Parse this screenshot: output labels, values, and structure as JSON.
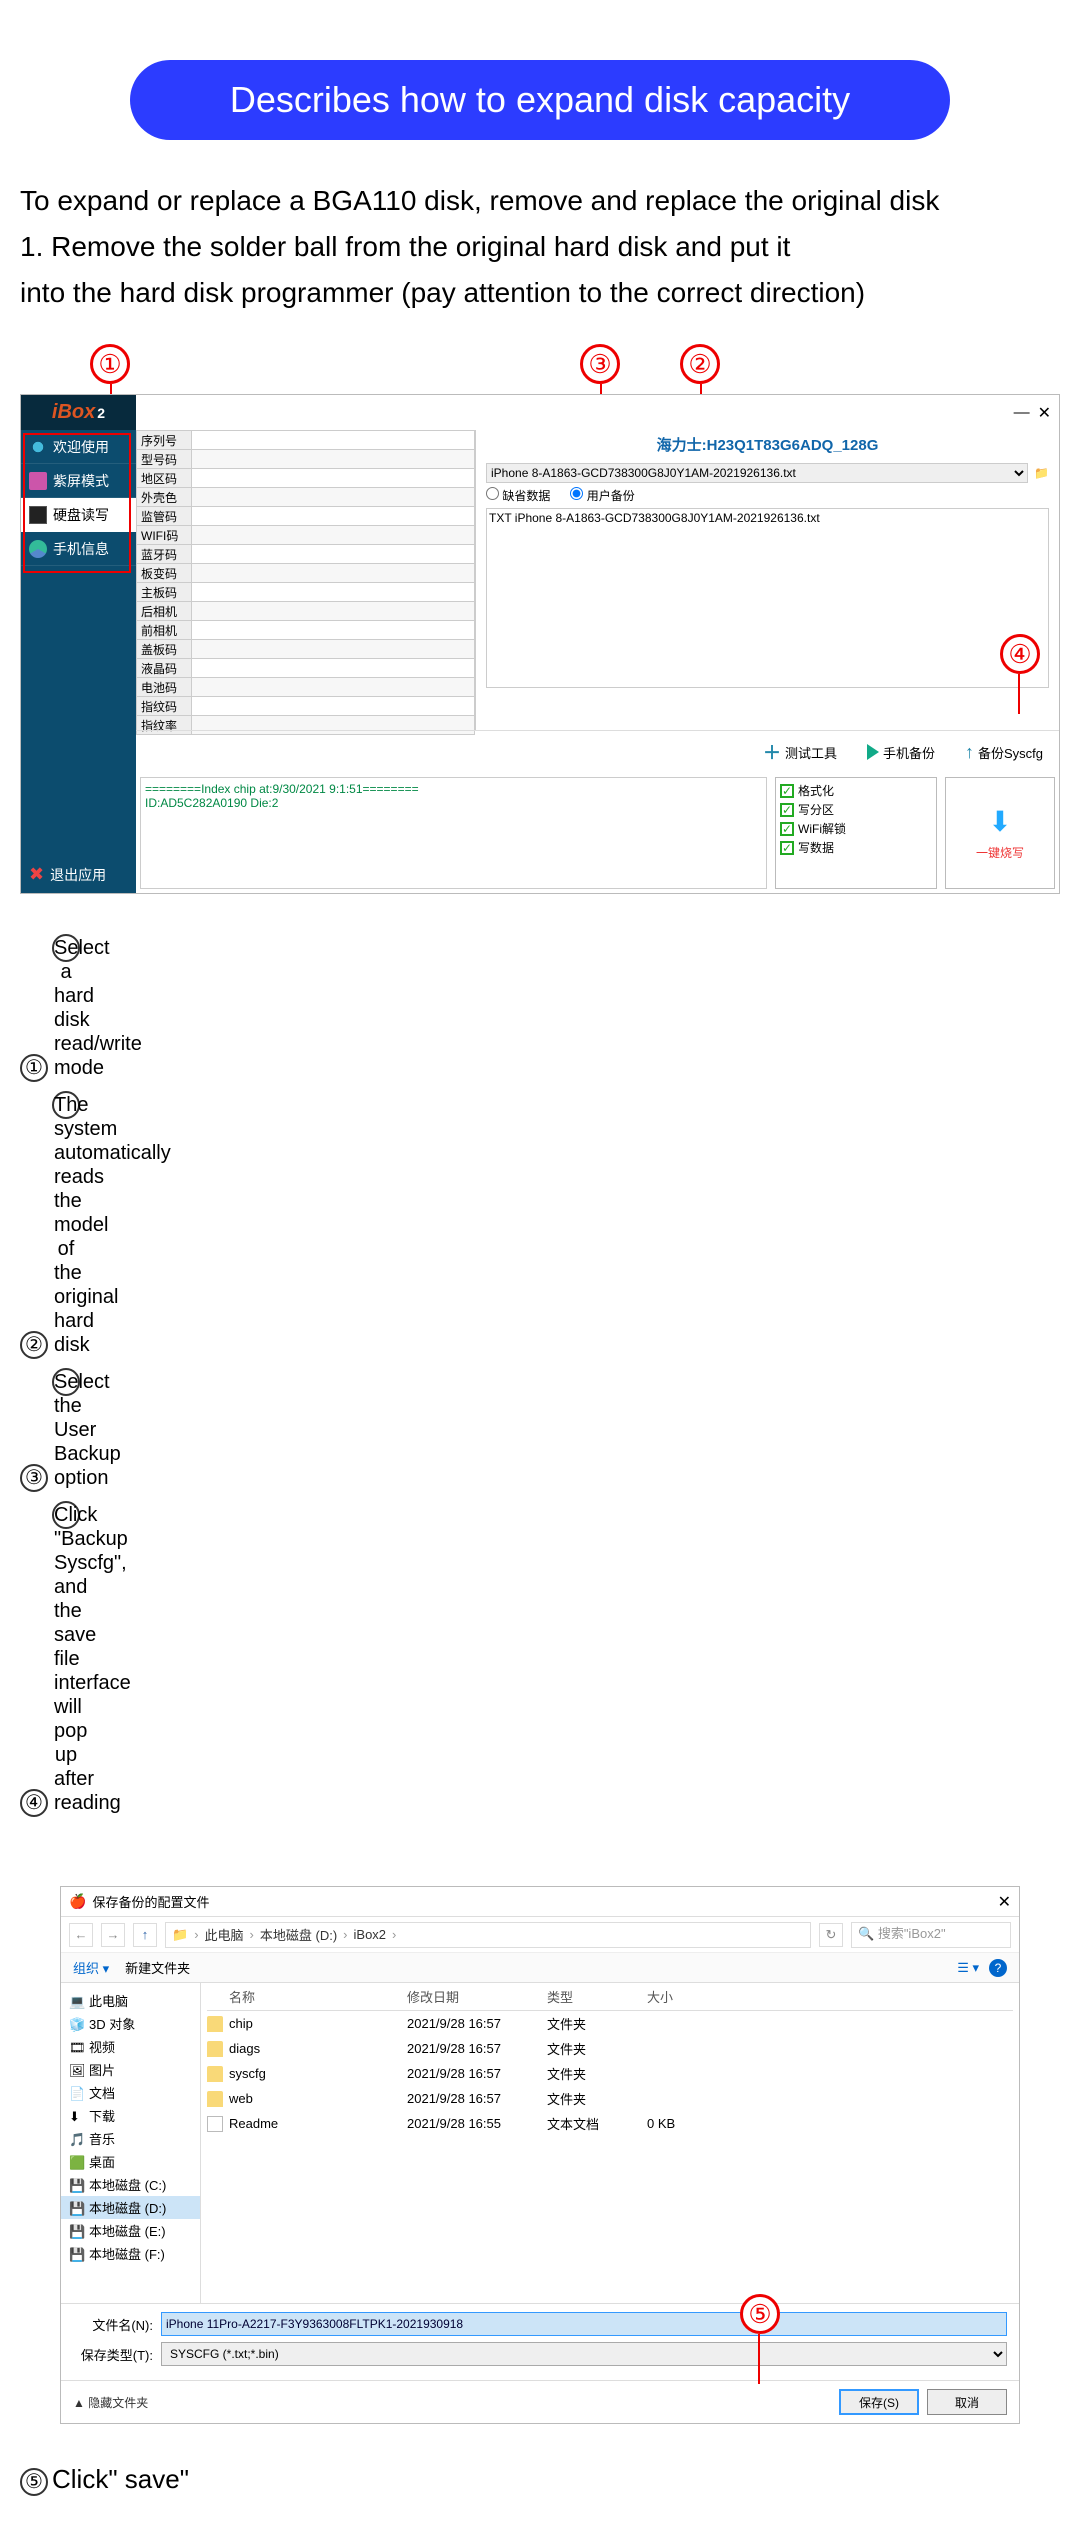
{
  "banner": "Describes how to expand disk capacity",
  "intro": [
    "To expand or replace a BGA110 disk, remove and replace the original disk",
    "1. Remove the solder ball from the original hard disk and put it",
    "into the hard disk programmer (pay attention to the correct direction)"
  ],
  "app": {
    "logo": "iBox",
    "logo2": "2",
    "sidebar": {
      "welcome": "欢迎使用",
      "purple": "紫屏模式",
      "hdd": "硬盘读写",
      "phone": "手机信息",
      "exit": "退出应用"
    },
    "props": [
      "序列号",
      "型号码",
      "地区码",
      "外壳色",
      "监管码",
      "WIFI码",
      "蓝牙码",
      "板变码",
      "主板码",
      "后相机",
      "前相机",
      "盖板码",
      "液晶码",
      "电池码",
      "指纹码",
      "指纹率"
    ],
    "chipLabel": "海力士:H23Q1T83G6ADQ_128G",
    "fileSelect": "iPhone 8-A1863-GCD738300G8J0Y1AM-2021926136.txt",
    "radio1": "缺省数据",
    "radio2": "用户备份",
    "fileListItem": "TXT iPhone 8-A1863-GCD738300G8J0Y1AM-2021926136.txt",
    "tools": {
      "test": "测试工具",
      "backup": "手机备份",
      "syscfg": "备份Syscfg"
    },
    "log": [
      "========Index chip at:9/30/2021 9:1:51========",
      "ID:AD5C282A0190 Die:2"
    ],
    "checks": [
      "格式化",
      "写分区",
      "WiFi解锁",
      "写数据"
    ],
    "burn": "一键烧写"
  },
  "steps": [
    "Select a hard disk read/write mode",
    "The system automatically reads the model of the original hard disk",
    "Select the User Backup option",
    "Click \"Backup Syscfg\", and the save file interface will pop up after reading"
  ],
  "dialog": {
    "title": "保存备份的配置文件",
    "crumbs": [
      "此电脑",
      "本地磁盘 (D:)",
      "iBox2"
    ],
    "searchPlaceholder": "搜索\"iBox2\"",
    "organize": "组织 ▾",
    "newFolder": "新建文件夹",
    "tree": [
      {
        "icon": "pc",
        "label": "此电脑"
      },
      {
        "icon": "3d",
        "label": "3D 对象"
      },
      {
        "icon": "vid",
        "label": "视频"
      },
      {
        "icon": "pic",
        "label": "图片"
      },
      {
        "icon": "doc",
        "label": "文档"
      },
      {
        "icon": "dl",
        "label": "下载"
      },
      {
        "icon": "music",
        "label": "音乐"
      },
      {
        "icon": "desk",
        "label": "桌面"
      },
      {
        "icon": "disk",
        "label": "本地磁盘 (C:)"
      },
      {
        "icon": "disk",
        "label": "本地磁盘 (D:)",
        "active": true
      },
      {
        "icon": "disk",
        "label": "本地磁盘 (E:)"
      },
      {
        "icon": "disk",
        "label": "本地磁盘 (F:)"
      }
    ],
    "headers": {
      "name": "名称",
      "date": "修改日期",
      "type": "类型",
      "size": "大小"
    },
    "files": [
      {
        "icon": "folder",
        "name": "chip",
        "date": "2021/9/28 16:57",
        "type": "文件夹",
        "size": ""
      },
      {
        "icon": "folder",
        "name": "diags",
        "date": "2021/9/28 16:57",
        "type": "文件夹",
        "size": ""
      },
      {
        "icon": "folder",
        "name": "syscfg",
        "date": "2021/9/28 16:57",
        "type": "文件夹",
        "size": ""
      },
      {
        "icon": "folder",
        "name": "web",
        "date": "2021/9/28 16:57",
        "type": "文件夹",
        "size": ""
      },
      {
        "icon": "txt",
        "name": "Readme",
        "date": "2021/9/28 16:55",
        "type": "文本文档",
        "size": "0 KB"
      }
    ],
    "fnameLabel": "文件名(N):",
    "fname": "iPhone 11Pro-A2217-F3Y9363008FLTPK1-2021930918",
    "ftypeLabel": "保存类型(T):",
    "ftype": "SYSCFG (*.txt;*.bin)",
    "hideFolders": "隐藏文件夹",
    "save": "保存(S)",
    "cancel": "取消"
  },
  "finalStep": "Click\" save\""
}
